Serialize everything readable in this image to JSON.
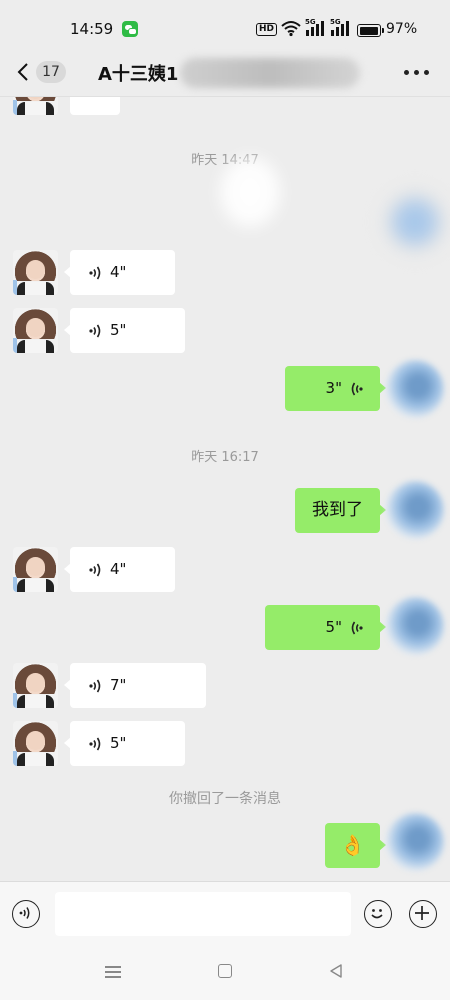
{
  "status_bar": {
    "time": "14:59",
    "hd_label": "HD",
    "network_1": "5G",
    "network_2": "5G",
    "battery_percent": "97%",
    "battery_level": 0.97
  },
  "header": {
    "unread_count": "17",
    "title": "A十三姨1"
  },
  "messages": {
    "timestamp_1": "昨天 14:47",
    "voice_1": "4\"",
    "voice_2": "5\"",
    "voice_3": "3\"",
    "timestamp_2": "昨天 16:17",
    "text_1": "我到了",
    "voice_4": "4\"",
    "voice_5": "5\"",
    "voice_6": "7\"",
    "voice_7": "5\"",
    "recall_notice": "你撤回了一条消息",
    "emoji_1": "👌"
  },
  "input_bar": {
    "text_value": ""
  },
  "colors": {
    "incoming_bubble": "#ffffff",
    "outgoing_bubble": "#95ec69",
    "background": "#ededed"
  }
}
